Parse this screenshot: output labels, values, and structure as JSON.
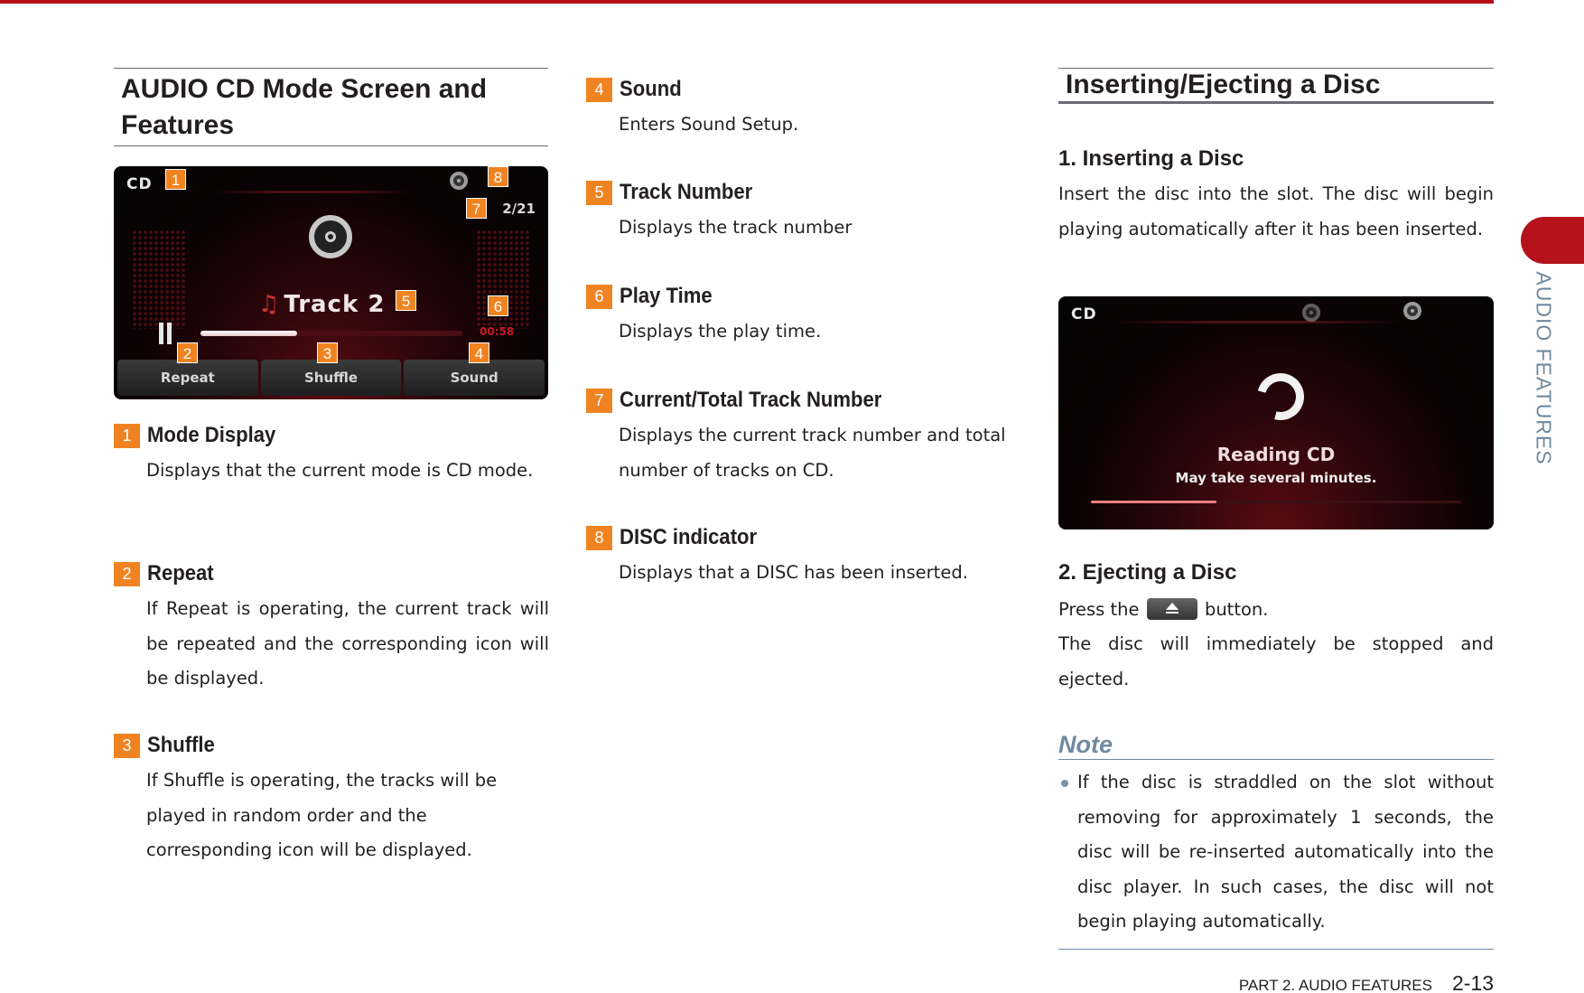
{
  "left": {
    "title": "AUDIO CD Mode Screen and Features",
    "screen": {
      "mode": "CD",
      "track_count": "2/21",
      "track_label": "Track 2",
      "play_time": "00:58",
      "progress_percent": 37,
      "buttons": [
        "Repeat",
        "Shuffle",
        "Sound"
      ],
      "callouts": [
        "1",
        "2",
        "3",
        "4",
        "5",
        "6",
        "7",
        "8"
      ]
    },
    "items": [
      {
        "num": "1",
        "title": "Mode Display",
        "body": "Displays that the current mode is CD mode."
      },
      {
        "num": "2",
        "title": "Repeat",
        "body": "If Repeat is operating, the current track will be repeated and the corresponding icon will be displayed."
      },
      {
        "num": "3",
        "title": "Shuffle",
        "body": "If Shuffle is operating, the tracks will be played in random order and the corresponding icon will be displayed."
      }
    ]
  },
  "middle": {
    "items": [
      {
        "num": "4",
        "title": "Sound",
        "body": "Enters Sound Setup."
      },
      {
        "num": "5",
        "title": "Track Number",
        "body": "Displays the track number"
      },
      {
        "num": "6",
        "title": "Play Time",
        "body": "Displays the play time."
      },
      {
        "num": "7",
        "title": "Current/Total Track Number",
        "body": "Displays the current track number and total number of tracks on CD."
      },
      {
        "num": "8",
        "title": "DISC indicator",
        "body": "Displays that a DISC has been inserted."
      }
    ]
  },
  "right": {
    "title": "Inserting/Ejecting a Disc",
    "inserting": {
      "heading": "1. Inserting a Disc",
      "body": "Insert the disc into the slot. The disc will begin playing automatically after it has been inserted."
    },
    "screen": {
      "mode": "CD",
      "status": "Reading CD",
      "sub": "May take several minutes.",
      "progress_percent": 34
    },
    "ejecting": {
      "heading": "2. Ejecting a Disc",
      "press_before": "Press the",
      "press_after": "button.",
      "body": "The disc will immediately be stopped and ejected."
    },
    "note": {
      "title": "Note",
      "body": "If the disc is straddled on the slot without removing for approximately 1   seconds, the disc will be re-inserted automatically into the disc player. In such cases, the disc will not begin playing automatically."
    }
  },
  "side_tab": "AUDIO FEATURES",
  "footer": {
    "part": "PART 2. AUDIO FEATURES",
    "page": "2-13"
  },
  "colors": {
    "accent_red": "#b5121b",
    "callout_orange": "#f08321",
    "note_blue": "#6f8aa0"
  }
}
